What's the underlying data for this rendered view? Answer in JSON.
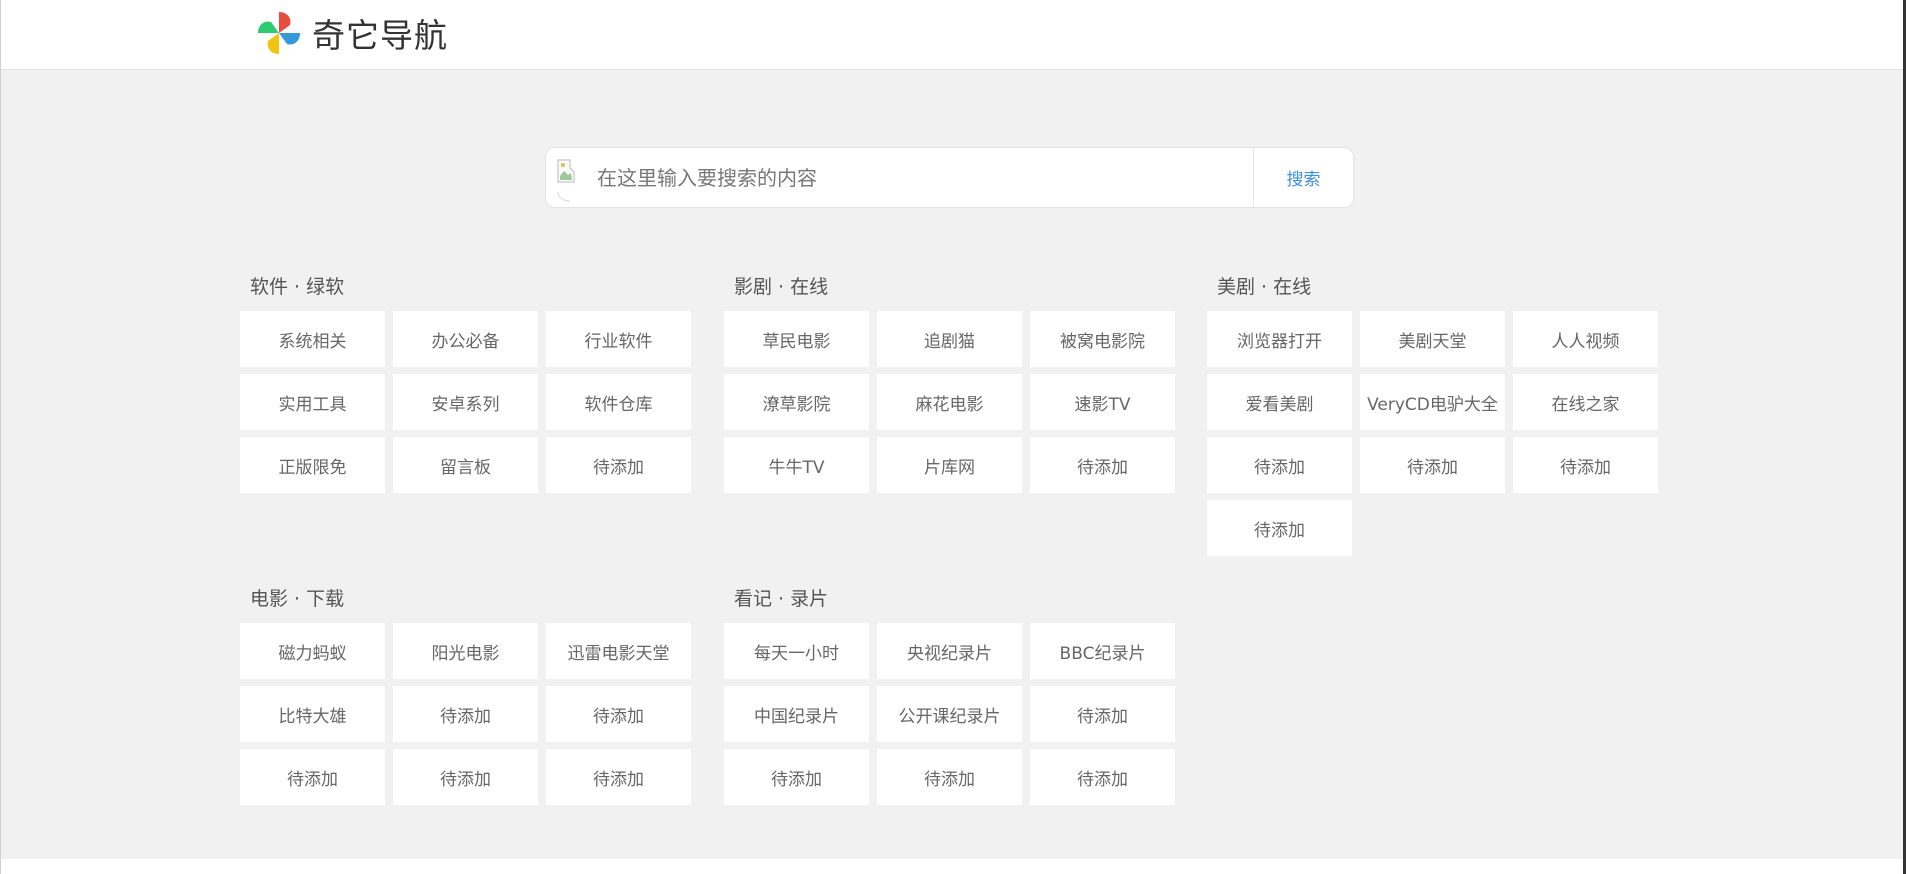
{
  "header": {
    "site_name": "奇它导航",
    "logo_icon": "pinwheel-logo-icon"
  },
  "search": {
    "placeholder": "在这里输入要搜索的内容",
    "value": "",
    "button_label": "搜索",
    "engine_icon": "broken-image-icon"
  },
  "colors": {
    "accent": "#3d8fe0",
    "page_bg": "#f1f1f1",
    "tile_bg": "#ffffff"
  },
  "sections": [
    {
      "title": "软件 · 绿软",
      "items": [
        "系统相关",
        "办公必备",
        "行业软件",
        "实用工具",
        "安卓系列",
        "软件仓库",
        "正版限免",
        "留言板",
        "待添加"
      ]
    },
    {
      "title": "影剧 · 在线",
      "items": [
        "草民电影",
        "追剧猫",
        "被窝电影院",
        "潦草影院",
        "麻花电影",
        "速影TV",
        "牛牛TV",
        "片库网",
        "待添加"
      ]
    },
    {
      "title": "美剧 · 在线",
      "items": [
        "浏览器打开",
        "美剧天堂",
        "人人视频",
        "爱看美剧",
        "VeryCD电驴大全",
        "在线之家",
        "待添加",
        "待添加",
        "待添加",
        "待添加"
      ]
    },
    {
      "title": "电影 · 下载",
      "items": [
        "磁力蚂蚁",
        "阳光电影",
        "迅雷电影天堂",
        "比特大雄",
        "待添加",
        "待添加",
        "待添加",
        "待添加",
        "待添加"
      ]
    },
    {
      "title": "看记 · 录片",
      "items": [
        "每天一小时",
        "央视纪录片",
        "BBC纪录片",
        "中国纪录片",
        "公开课纪录片",
        "待添加",
        "待添加",
        "待添加",
        "待添加"
      ]
    }
  ]
}
